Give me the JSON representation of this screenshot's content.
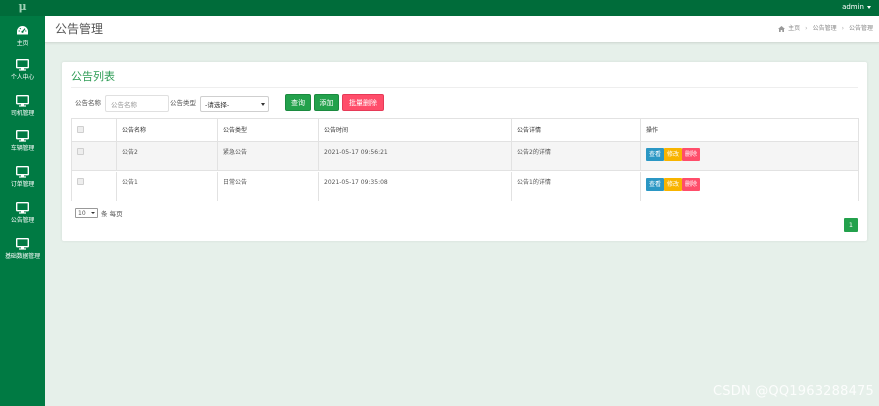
{
  "app": {
    "logo": "μ",
    "user": "admin"
  },
  "sidebar": {
    "items": [
      {
        "label": "主页",
        "icon": "dashboard-icon"
      },
      {
        "label": "个人中心",
        "icon": "monitor-icon"
      },
      {
        "label": "司机管理",
        "icon": "monitor-icon"
      },
      {
        "label": "车辆管理",
        "icon": "monitor-icon"
      },
      {
        "label": "订单管理",
        "icon": "monitor-icon"
      },
      {
        "label": "公告管理",
        "icon": "monitor-icon"
      },
      {
        "label": "基础数据管理",
        "icon": "monitor-icon"
      }
    ]
  },
  "header": {
    "title": "公告管理",
    "breadcrumb": [
      "主页",
      "公告管理",
      "公告管理"
    ]
  },
  "panel": {
    "title": "公告列表"
  },
  "search": {
    "name_label": "公告名称",
    "name_placeholder": "公告名称",
    "type_label": "公告类型",
    "type_selected": "-请选择-"
  },
  "toolbar": {
    "query": "查询",
    "add": "添加",
    "batch_delete": "批量删除"
  },
  "table": {
    "headers": [
      "公告名称",
      "公告类型",
      "公告时间",
      "公告详情",
      "操作"
    ],
    "rows": [
      {
        "name": "公告2",
        "type": "紧急公告",
        "time": "2021-05-17 09:56:21",
        "detail": "公告2的详情"
      },
      {
        "name": "公告1",
        "type": "日常公告",
        "time": "2021-05-17 09:35:08",
        "detail": "公告1的详情"
      }
    ],
    "actions": {
      "view": "查看",
      "edit": "修改",
      "delete": "删除"
    }
  },
  "pagination": {
    "page_size": "10",
    "page_size_suffix": "条 每页",
    "current_page": "1"
  },
  "watermark": "CSDN @QQ1963288475",
  "colors": {
    "primary": "#007a43",
    "topbar": "#006c3a",
    "accent": "#23a14c",
    "danger": "#ff4d6a",
    "warning": "#f8b400",
    "info": "#2b97c4"
  }
}
